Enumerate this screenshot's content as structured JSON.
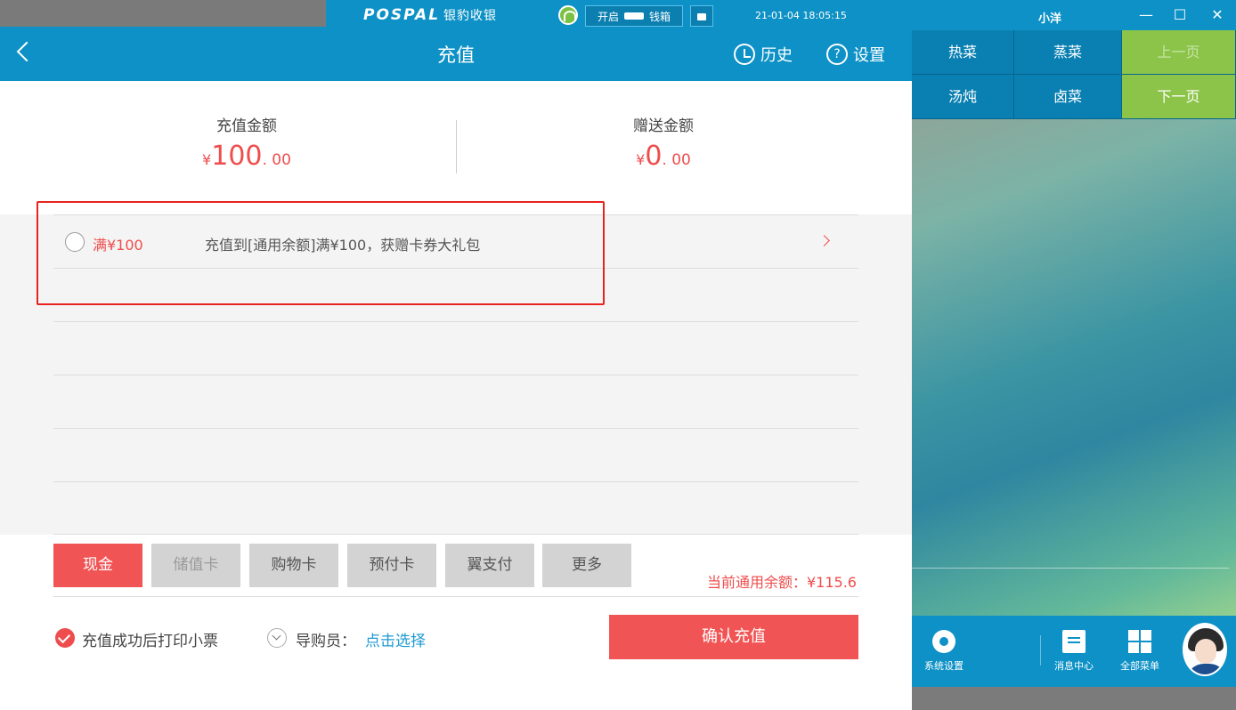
{
  "system_bar": {
    "logo_en": "POSPAL",
    "logo_cn": "银豹收银",
    "drawer_open": "开启",
    "drawer_label": "钱箱",
    "datetime": "21-01-04 18:05:15",
    "user_name": "小洋",
    "minimize": "—",
    "maximize": "☐",
    "close": "✕"
  },
  "header": {
    "title": "充值",
    "history_label": "历史",
    "settings_label": "设置",
    "help_glyph": "?"
  },
  "amounts": {
    "recharge_label": "充值金额",
    "recharge_symbol": "¥",
    "recharge_integer": "100",
    "recharge_decimal": ". 00",
    "bonus_label": "赠送金额",
    "bonus_symbol": "¥",
    "bonus_integer": "0",
    "bonus_decimal": ". 00"
  },
  "promotions": [
    {
      "name": "满¥100",
      "description": "充值到[通用余额]满¥100，获赠卡券大礼包"
    }
  ],
  "payment_methods": [
    {
      "label": "现金",
      "state": "active"
    },
    {
      "label": "储值卡",
      "state": "disabled"
    },
    {
      "label": "购物卡",
      "state": "normal"
    },
    {
      "label": "预付卡",
      "state": "normal"
    },
    {
      "label": "翼支付",
      "state": "normal"
    },
    {
      "label": "更多",
      "state": "normal"
    }
  ],
  "balance_text": "当前通用余额：¥115.6",
  "footer": {
    "print_receipt_label": "充值成功后打印小票",
    "print_receipt_checked": true,
    "guide_label": "导购员：",
    "guide_link": "点击选择",
    "confirm_label": "确认充值"
  },
  "right_panel": {
    "categories": [
      {
        "label": "热菜"
      },
      {
        "label": "蒸菜"
      },
      {
        "label": "上一页"
      },
      {
        "label": "汤炖"
      },
      {
        "label": "卤菜"
      },
      {
        "label": "下一页"
      }
    ],
    "dock": [
      {
        "label": "系统设置",
        "icon": "gear-icon"
      },
      {
        "label": "消息中心",
        "icon": "message-icon"
      },
      {
        "label": "全部菜单",
        "icon": "grid-icon"
      }
    ]
  },
  "colors": {
    "primary_blue": "#0d91c6",
    "accent_red": "#f15454",
    "green": "#8cc44a",
    "highlight_red": "#e8231f"
  }
}
